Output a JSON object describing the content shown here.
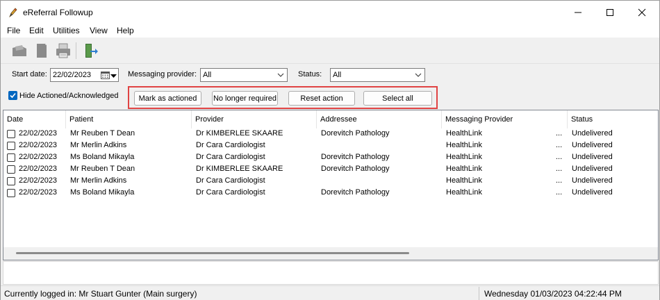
{
  "window": {
    "title": "eReferral Followup"
  },
  "menu": [
    "File",
    "Edit",
    "Utilities",
    "View",
    "Help"
  ],
  "toolbar": {
    "icons": [
      "letter-icon",
      "document-icon",
      "print-icon",
      "exit-icon"
    ]
  },
  "filters": {
    "start_date_label": "Start date:",
    "start_date_value": "22/02/2023",
    "provider_label": "Messaging provider:",
    "provider_value": "All",
    "status_label": "Status:",
    "status_value": "All",
    "hide_label": "Hide Actioned/Acknowledged",
    "hide_checked": true
  },
  "actions": {
    "mark_actioned": "Mark as actioned",
    "no_longer_required": "No longer required",
    "reset_action": "Reset action",
    "select_all": "Select all"
  },
  "table": {
    "columns": [
      "Date",
      "Patient",
      "Provider",
      "Addressee",
      "Messaging Provider",
      "Status"
    ],
    "rows": [
      {
        "date": "22/02/2023",
        "patient": "Mr Reuben T Dean",
        "provider": "Dr KIMBERLEE SKAARE",
        "addressee": "Dorevitch Pathology",
        "messaging_provider": "HealthLink",
        "dots": "...",
        "status": "Undelivered"
      },
      {
        "date": "22/02/2023",
        "patient": "Mr Merlin Adkins",
        "provider": "Dr Cara Cardiologist",
        "addressee": "",
        "messaging_provider": "HealthLink",
        "dots": "...",
        "status": "Undelivered"
      },
      {
        "date": "22/02/2023",
        "patient": "Ms Boland Mikayla",
        "provider": "Dr Cara Cardiologist",
        "addressee": "Dorevitch Pathology",
        "messaging_provider": "HealthLink",
        "dots": "...",
        "status": "Undelivered"
      },
      {
        "date": "22/02/2023",
        "patient": "Mr Reuben T Dean",
        "provider": "Dr KIMBERLEE SKAARE",
        "addressee": "Dorevitch Pathology",
        "messaging_provider": "HealthLink",
        "dots": "...",
        "status": "Undelivered"
      },
      {
        "date": "22/02/2023",
        "patient": "Mr Merlin Adkins",
        "provider": "Dr Cara Cardiologist",
        "addressee": "",
        "messaging_provider": "HealthLink",
        "dots": "...",
        "status": "Undelivered"
      },
      {
        "date": "22/02/2023",
        "patient": "Ms Boland Mikayla",
        "provider": "Dr Cara Cardiologist",
        "addressee": "Dorevitch Pathology",
        "messaging_provider": "HealthLink",
        "dots": "...",
        "status": "Undelivered"
      }
    ]
  },
  "status_bar": {
    "logged_in": "Currently logged in:  Mr Stuart Gunter (Main surgery)",
    "datetime": "Wednesday 01/03/2023 04:22:44 PM"
  },
  "colors": {
    "accent": "#0067c0",
    "highlight_border": "#e04343"
  }
}
